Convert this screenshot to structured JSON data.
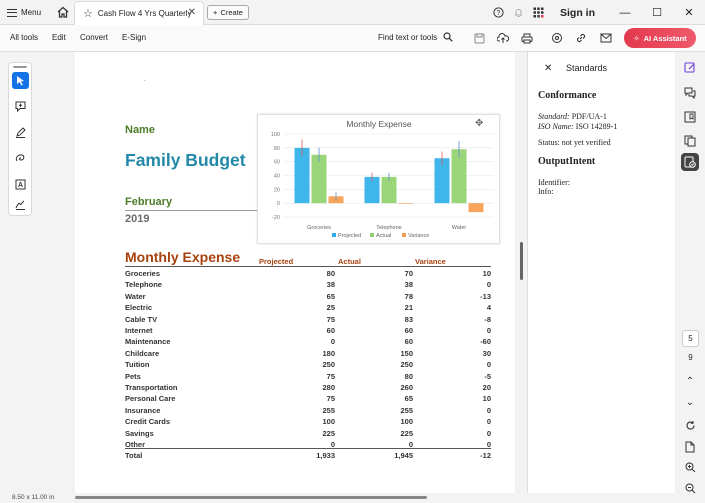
{
  "titlebar": {
    "menu_label": "Menu",
    "tab_title": "Cash Flow 4 Yrs Quarterly",
    "create_label": "Create",
    "signin_label": "Sign in"
  },
  "toolbar": {
    "all_tools": "All tools",
    "edit": "Edit",
    "convert": "Convert",
    "esign": "E-Sign",
    "find": "Find text or tools",
    "ai_assistant": "AI Assistant"
  },
  "document": {
    "name_label": "Name",
    "title": "Family Budget",
    "month": "February",
    "year": "2019",
    "table_title": "Monthly Expense",
    "columns": [
      "Projected",
      "Actual",
      "Variance"
    ],
    "rows": [
      {
        "label": "Groceries",
        "projected": "80",
        "actual": "70",
        "variance": "10"
      },
      {
        "label": "Telephone",
        "projected": "38",
        "actual": "38",
        "variance": "0"
      },
      {
        "label": "Water",
        "projected": "65",
        "actual": "78",
        "variance": "-13"
      },
      {
        "label": "Electric",
        "projected": "25",
        "actual": "21",
        "variance": "4"
      },
      {
        "label": "Cable TV",
        "projected": "75",
        "actual": "83",
        "variance": "-8"
      },
      {
        "label": "Internet",
        "projected": "60",
        "actual": "60",
        "variance": "0"
      },
      {
        "label": "Maintenance",
        "projected": "0",
        "actual": "60",
        "variance": "-60"
      },
      {
        "label": "Childcare",
        "projected": "180",
        "actual": "150",
        "variance": "30"
      },
      {
        "label": "Tuition",
        "projected": "250",
        "actual": "250",
        "variance": "0"
      },
      {
        "label": "Pets",
        "projected": "75",
        "actual": "80",
        "variance": "-5"
      },
      {
        "label": "Transportation",
        "projected": "280",
        "actual": "260",
        "variance": "20"
      },
      {
        "label": "Personal Care",
        "projected": "75",
        "actual": "65",
        "variance": "10"
      },
      {
        "label": "Insurance",
        "projected": "255",
        "actual": "255",
        "variance": "0"
      },
      {
        "label": "Credit Cards",
        "projected": "100",
        "actual": "100",
        "variance": "0"
      },
      {
        "label": "Savings",
        "projected": "225",
        "actual": "225",
        "variance": "0"
      },
      {
        "label": "Other",
        "projected": "0",
        "actual": "0",
        "variance": "0"
      }
    ],
    "total": {
      "label": "Total",
      "projected": "1,933",
      "actual": "1,945",
      "variance": "-12"
    }
  },
  "chart_data": {
    "type": "bar",
    "title": "Monthly Expense",
    "categories": [
      "Groceries",
      "Telephone",
      "Water"
    ],
    "series": [
      {
        "name": "Projected",
        "values": [
          80,
          38,
          65
        ],
        "color": "#29aee8"
      },
      {
        "name": "Actual",
        "values": [
          70,
          38,
          78
        ],
        "color": "#8fd16a"
      },
      {
        "name": "Variance",
        "values": [
          10,
          0,
          -13
        ],
        "color": "#f79a4a"
      }
    ],
    "ylim": [
      -20,
      100
    ],
    "yticks": [
      "100",
      "80",
      "60",
      "40",
      "20",
      "0",
      "-20"
    ],
    "legend": "bottom",
    "grid": true,
    "error_bars": true
  },
  "panel": {
    "title": "Standards",
    "conformance_heading": "Conformance",
    "standard_label": "Standard:",
    "standard_value": "PDF/UA-1",
    "iso_label": "ISO Name:",
    "iso_value": "ISO 14289-1",
    "status": "Status:  not yet verified",
    "output_heading": "OutputIntent",
    "identifier": "Identifier:",
    "info": "Info:"
  },
  "pagenav": {
    "current": "5",
    "total": "9"
  },
  "status": {
    "page_size": "8.50 x 11.00 in"
  },
  "colors": {
    "accent": "#1473e6",
    "ai": "#e3384d",
    "doc_green": "#4e7b2a",
    "doc_blue": "#2389a8",
    "doc_orange": "#a8420f"
  }
}
